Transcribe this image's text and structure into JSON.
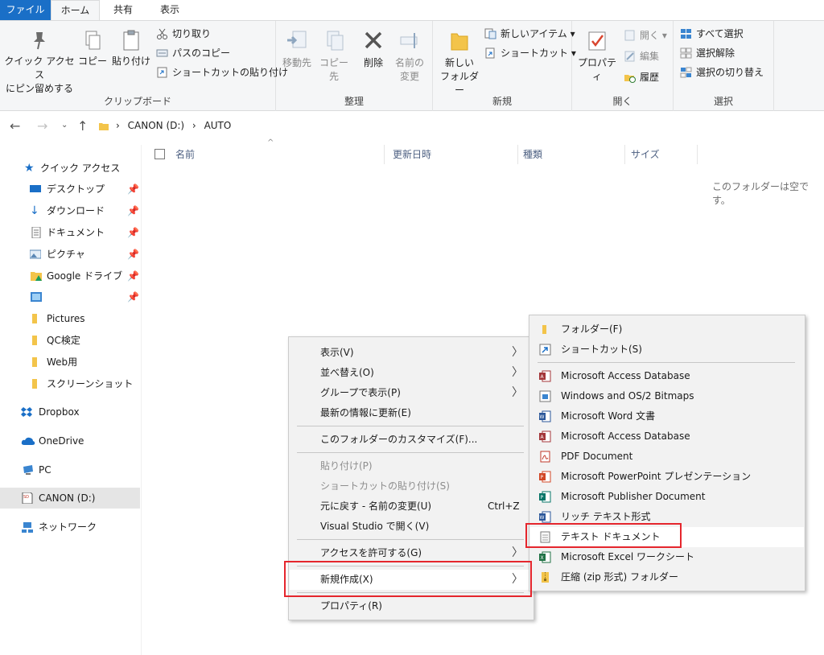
{
  "tabs": {
    "file": "ファイル",
    "home": "ホーム",
    "share": "共有",
    "view": "表示"
  },
  "ribbon": {
    "clipboard": {
      "pin_label_1": "クイック アクセス",
      "pin_label_2": "にピン留めする",
      "copy": "コピー",
      "paste": "貼り付け",
      "cut": "切り取り",
      "copy_path": "パスのコピー",
      "paste_shortcut": "ショートカットの貼り付け",
      "group": "クリップボード"
    },
    "organize": {
      "move_to": "移動先",
      "copy_to": "コピー先",
      "delete": "削除",
      "rename_1": "名前の",
      "rename_2": "変更",
      "group": "整理"
    },
    "new": {
      "new_folder_1": "新しい",
      "new_folder_2": "フォルダー",
      "new_item": "新しいアイテム",
      "shortcut": "ショートカット",
      "group": "新規"
    },
    "open": {
      "properties": "プロパティ",
      "open": "開く",
      "edit": "編集",
      "history": "履歴",
      "group": "開く"
    },
    "select": {
      "select_all": "すべて選択",
      "select_none": "選択解除",
      "invert": "選択の切り替え",
      "group": "選択"
    }
  },
  "address": {
    "drive": "CANON (D:)",
    "folder": "AUTO",
    "separator": "›"
  },
  "nav": {
    "quick_access": "クイック アクセス",
    "desktop": "デスクトップ",
    "downloads": "ダウンロード",
    "documents": "ドキュメント",
    "pictures_jp": "ピクチャ",
    "google_drive": "Google ドライブ",
    "pictures": "Pictures",
    "qc": "QC検定",
    "web": "Web用",
    "screenshots": "スクリーンショット",
    "dropbox": "Dropbox",
    "onedrive": "OneDrive",
    "pc": "PC",
    "canon": "CANON (D:)",
    "network": "ネットワーク"
  },
  "columns": {
    "name": "名前",
    "modified": "更新日時",
    "type": "種類",
    "size": "サイズ"
  },
  "empty_message": "このフォルダーは空です。",
  "context_menu": {
    "view": "表示(V)",
    "sort": "並べ替え(O)",
    "group": "グループで表示(P)",
    "refresh": "最新の情報に更新(E)",
    "customize": "このフォルダーのカスタマイズ(F)...",
    "paste": "貼り付け(P)",
    "paste_shortcut": "ショートカットの貼り付け(S)",
    "undo": "元に戻す - 名前の変更(U)",
    "undo_shortcut": "Ctrl+Z",
    "vs": "Visual Studio で開く(V)",
    "access": "アクセスを許可する(G)",
    "new": "新規作成(X)",
    "properties": "プロパティ(R)",
    "arrow": "〉"
  },
  "submenu": {
    "folder": "フォルダー(F)",
    "shortcut": "ショートカット(S)",
    "access_db": "Microsoft Access Database",
    "bitmap": "Windows and OS/2 Bitmaps",
    "word": "Microsoft Word 文書",
    "access_db2": "Microsoft Access Database",
    "pdf": "PDF Document",
    "ppt": "Microsoft PowerPoint プレゼンテーション",
    "publisher": "Microsoft Publisher Document",
    "rtf": "リッチ テキスト形式",
    "text": "テキスト ドキュメント",
    "excel": "Microsoft Excel ワークシート",
    "zip": "圧縮 (zip 形式) フォルダー"
  },
  "colors": {
    "accent": "#1a6fc7",
    "highlight_box": "#e5262d",
    "folder": "#e8b32e"
  }
}
